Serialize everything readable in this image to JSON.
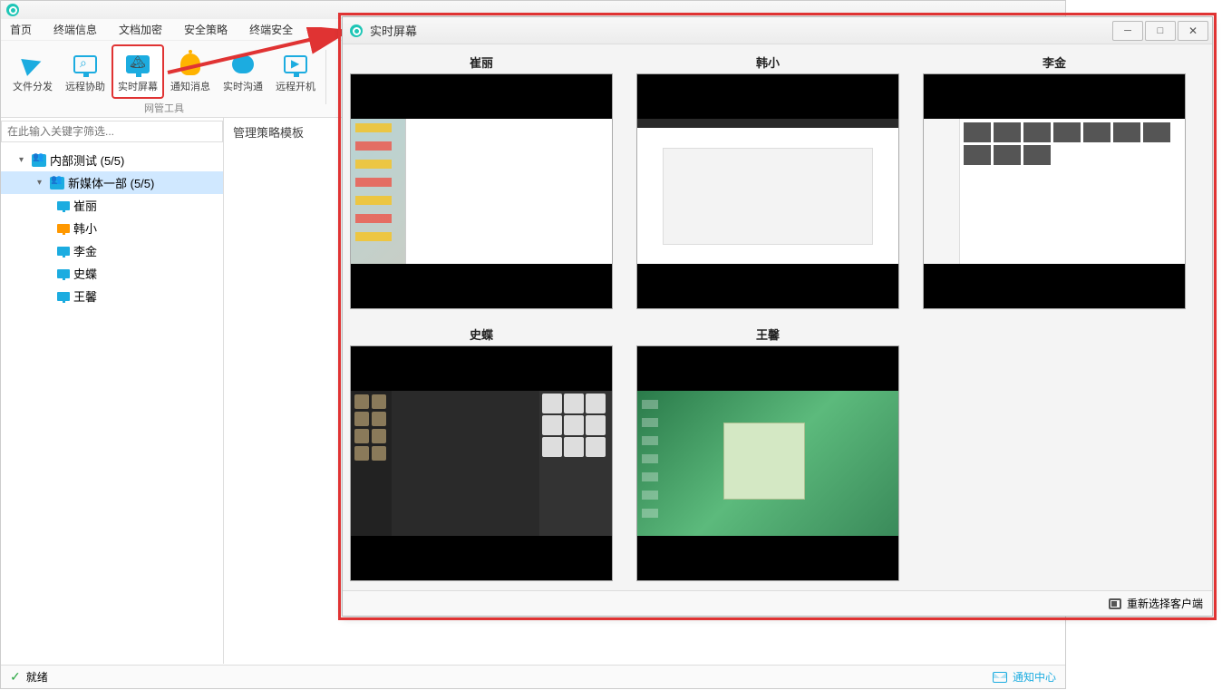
{
  "main_menu": {
    "items": [
      "首页",
      "终端信息",
      "文档加密",
      "安全策略",
      "终端安全"
    ]
  },
  "toolbar": {
    "items": [
      {
        "label": "文件分发"
      },
      {
        "label": "远程协助"
      },
      {
        "label": "实时屏幕"
      },
      {
        "label": "通知消息"
      },
      {
        "label": "实时沟通"
      },
      {
        "label": "远程开机"
      }
    ],
    "group_label": "网管工具"
  },
  "sidebar": {
    "filter_placeholder": "在此输入关键字筛选...",
    "tree": {
      "root": {
        "label": "内部测试 (5/5)"
      },
      "group": {
        "label": "新媒体一部 (5/5)"
      },
      "users": [
        "崔丽",
        "韩小",
        "李金",
        "史蝶",
        "王馨"
      ]
    }
  },
  "panel": {
    "title": "管理策略模板"
  },
  "statusbar": {
    "ready": "就绪",
    "notification": "通知中心"
  },
  "popup": {
    "title": "实时屏幕",
    "screens": [
      "崔丽",
      "韩小",
      "李金",
      "史蝶",
      "王馨"
    ],
    "footer_action": "重新选择客户端"
  }
}
